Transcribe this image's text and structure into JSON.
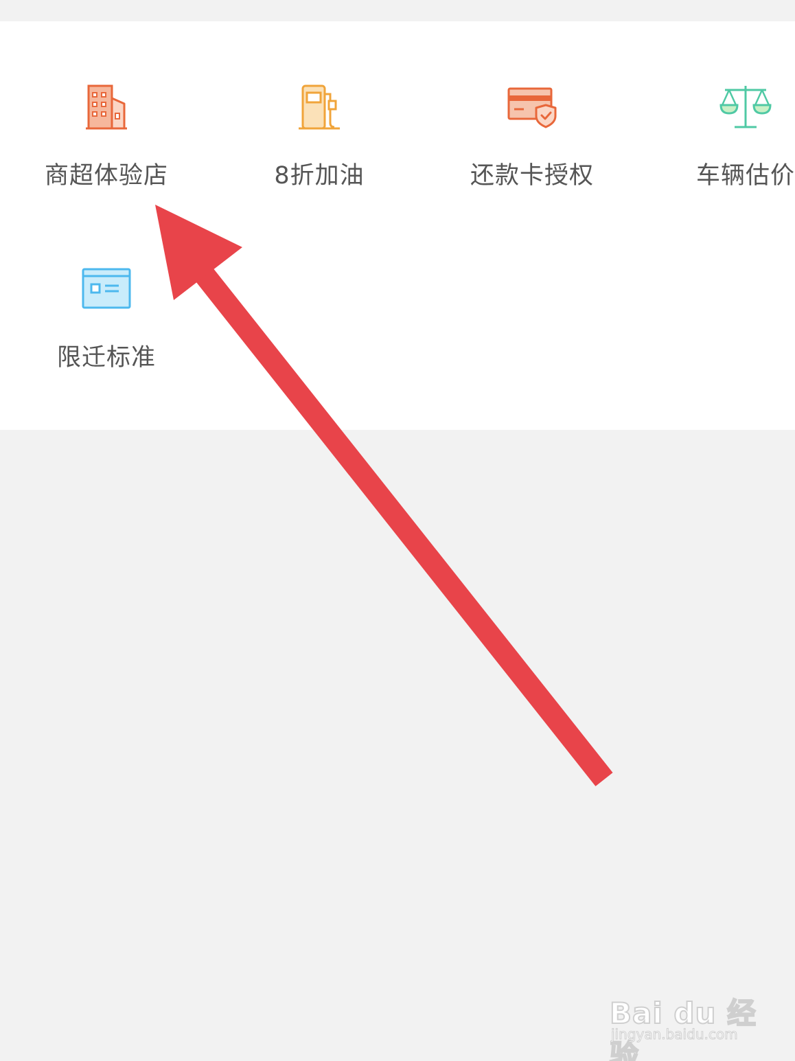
{
  "grid": {
    "items": [
      {
        "label": "商超体验店",
        "icon": "store-building-icon",
        "color": "#e8673a"
      },
      {
        "label": "8折加油",
        "icon": "gas-pump-icon",
        "color": "#f0a43a"
      },
      {
        "label": "还款卡授权",
        "icon": "card-shield-icon",
        "color": "#e8673a"
      },
      {
        "label": "车辆估价",
        "icon": "scale-balance-icon",
        "color": "#4fc9a4"
      },
      {
        "label": "限迁标准",
        "icon": "id-card-icon",
        "color": "#4cb8ee"
      }
    ]
  },
  "annotation": {
    "arrow_color": "#e8444a",
    "points_to": "商超体验店"
  },
  "watermark": {
    "logo": "Bai du 经验",
    "url": "jingyan.baidu.com"
  }
}
